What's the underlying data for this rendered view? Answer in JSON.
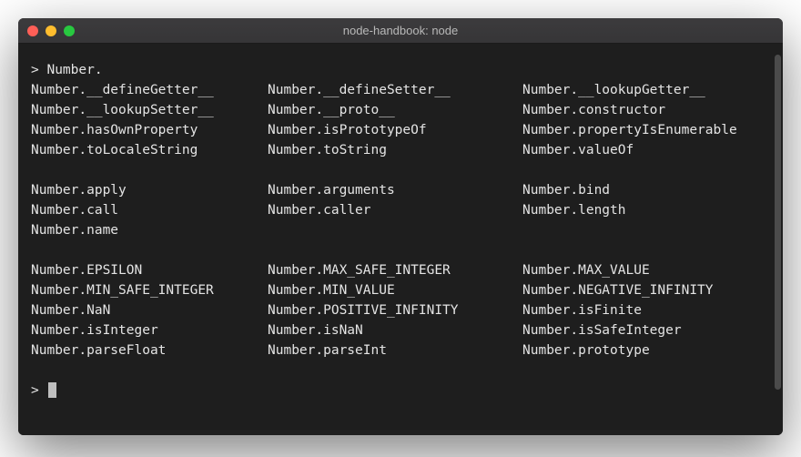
{
  "window": {
    "title": "node-handbook: node"
  },
  "terminal": {
    "prompt": "> ",
    "input": "Number.",
    "groups": [
      [
        [
          "Number.__defineGetter__",
          "Number.__defineSetter__",
          "Number.__lookupGetter__"
        ],
        [
          "Number.__lookupSetter__",
          "Number.__proto__",
          "Number.constructor"
        ],
        [
          "Number.hasOwnProperty",
          "Number.isPrototypeOf",
          "Number.propertyIsEnumerable"
        ],
        [
          "Number.toLocaleString",
          "Number.toString",
          "Number.valueOf"
        ]
      ],
      [
        [
          "Number.apply",
          "Number.arguments",
          "Number.bind"
        ],
        [
          "Number.call",
          "Number.caller",
          "Number.length"
        ],
        [
          "Number.name",
          "",
          ""
        ]
      ],
      [
        [
          "Number.EPSILON",
          "Number.MAX_SAFE_INTEGER",
          "Number.MAX_VALUE"
        ],
        [
          "Number.MIN_SAFE_INTEGER",
          "Number.MIN_VALUE",
          "Number.NEGATIVE_INFINITY"
        ],
        [
          "Number.NaN",
          "Number.POSITIVE_INFINITY",
          "Number.isFinite"
        ],
        [
          "Number.isInteger",
          "Number.isNaN",
          "Number.isSafeInteger"
        ],
        [
          "Number.parseFloat",
          "Number.parseInt",
          "Number.prototype"
        ]
      ]
    ],
    "prompt2": "> "
  }
}
